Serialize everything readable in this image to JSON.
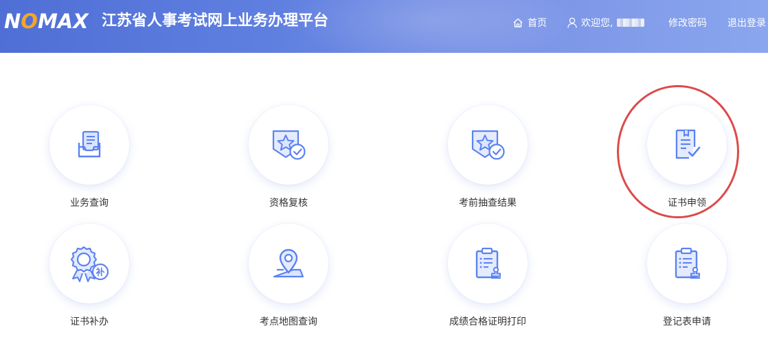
{
  "header": {
    "logo_prefix": "N",
    "logo_o": "O",
    "logo_suffix": "MAX",
    "title": "江苏省人事考试网上业务办理平台",
    "nav": {
      "home": "首页",
      "welcome": "欢迎您,",
      "change_password": "修改密码",
      "logout": "退出登录"
    }
  },
  "tiles": [
    {
      "label": "业务查询",
      "icon": "inbox-tray-icon"
    },
    {
      "label": "资格复核",
      "icon": "star-badge-check-icon"
    },
    {
      "label": "考前抽查结果",
      "icon": "star-badge-check-icon"
    },
    {
      "label": "证书申领",
      "icon": "certificate-check-icon"
    },
    {
      "label": "证书补办",
      "icon": "award-seal-supplement-icon"
    },
    {
      "label": "考点地图查询",
      "icon": "map-pin-icon"
    },
    {
      "label": "成绩合格证明打印",
      "icon": "clipboard-stamp-icon"
    },
    {
      "label": "登记表申请",
      "icon": "clipboard-stamp-icon"
    }
  ],
  "supplement_char": "补",
  "colors": {
    "header_start": "#4f6fd6",
    "header_end": "#8aa6ee",
    "icon_blue": "#5b82f0",
    "icon_light": "#dbe5ff",
    "logo_accent": "#f5a623",
    "annotation_red": "#dc4a4a"
  }
}
